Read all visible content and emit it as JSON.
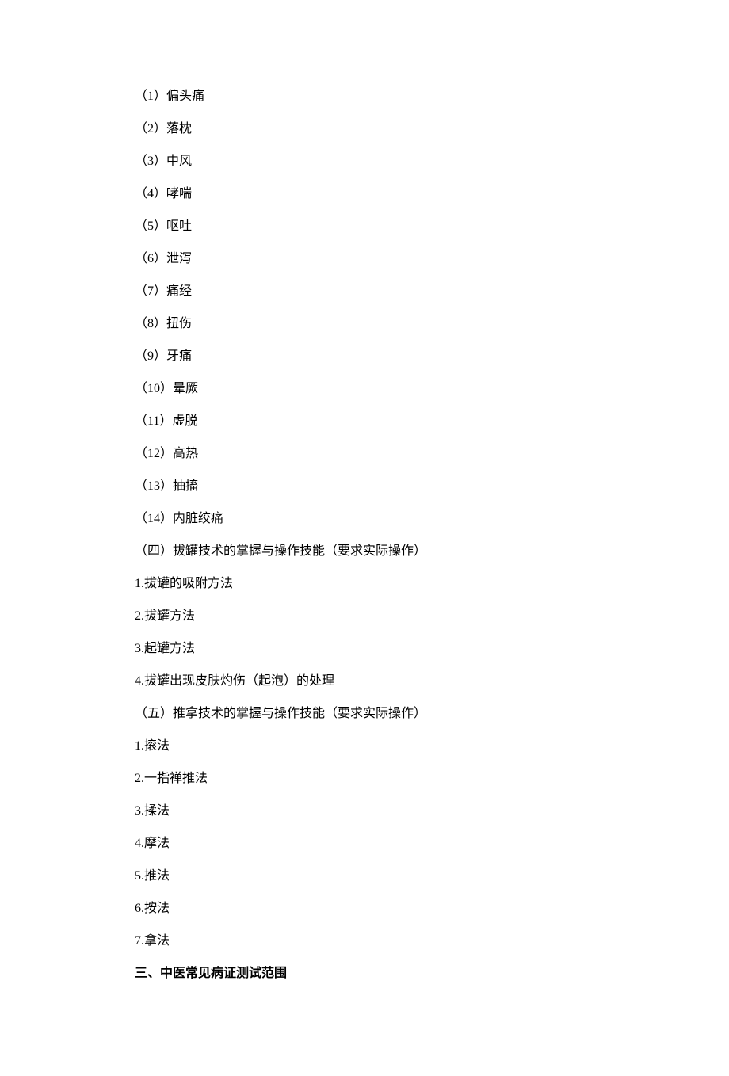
{
  "lines": [
    {
      "text": "（1）偏头痛",
      "bold": false
    },
    {
      "text": "（2）落枕",
      "bold": false
    },
    {
      "text": "（3）中风",
      "bold": false
    },
    {
      "text": "（4）哮喘",
      "bold": false
    },
    {
      "text": "（5）呕吐",
      "bold": false
    },
    {
      "text": "（6）泄泻",
      "bold": false
    },
    {
      "text": "（7）痛经",
      "bold": false
    },
    {
      "text": "（8）扭伤",
      "bold": false
    },
    {
      "text": "（9）牙痛",
      "bold": false
    },
    {
      "text": "（10）晕厥",
      "bold": false
    },
    {
      "text": "（11）虚脱",
      "bold": false
    },
    {
      "text": "（12）高热",
      "bold": false
    },
    {
      "text": "（13）抽搐",
      "bold": false
    },
    {
      "text": "（14）内脏绞痛",
      "bold": false
    },
    {
      "text": "（四）拔罐技术的掌握与操作技能（要求实际操作）",
      "bold": false
    },
    {
      "text": "1.拔罐的吸附方法",
      "bold": false
    },
    {
      "text": "2.拔罐方法",
      "bold": false
    },
    {
      "text": "3.起罐方法",
      "bold": false
    },
    {
      "text": "4.拔罐出现皮肤灼伤（起泡）的处理",
      "bold": false
    },
    {
      "text": "（五）推拿技术的掌握与操作技能（要求实际操作）",
      "bold": false
    },
    {
      "text": "1.㨰法",
      "bold": false
    },
    {
      "text": "2.一指禅推法",
      "bold": false
    },
    {
      "text": "3.揉法",
      "bold": false
    },
    {
      "text": "4.摩法",
      "bold": false
    },
    {
      "text": "5.推法",
      "bold": false
    },
    {
      "text": "6.按法",
      "bold": false
    },
    {
      "text": "7.拿法",
      "bold": false
    },
    {
      "text": "三、中医常见病证测试范围",
      "bold": true
    }
  ]
}
